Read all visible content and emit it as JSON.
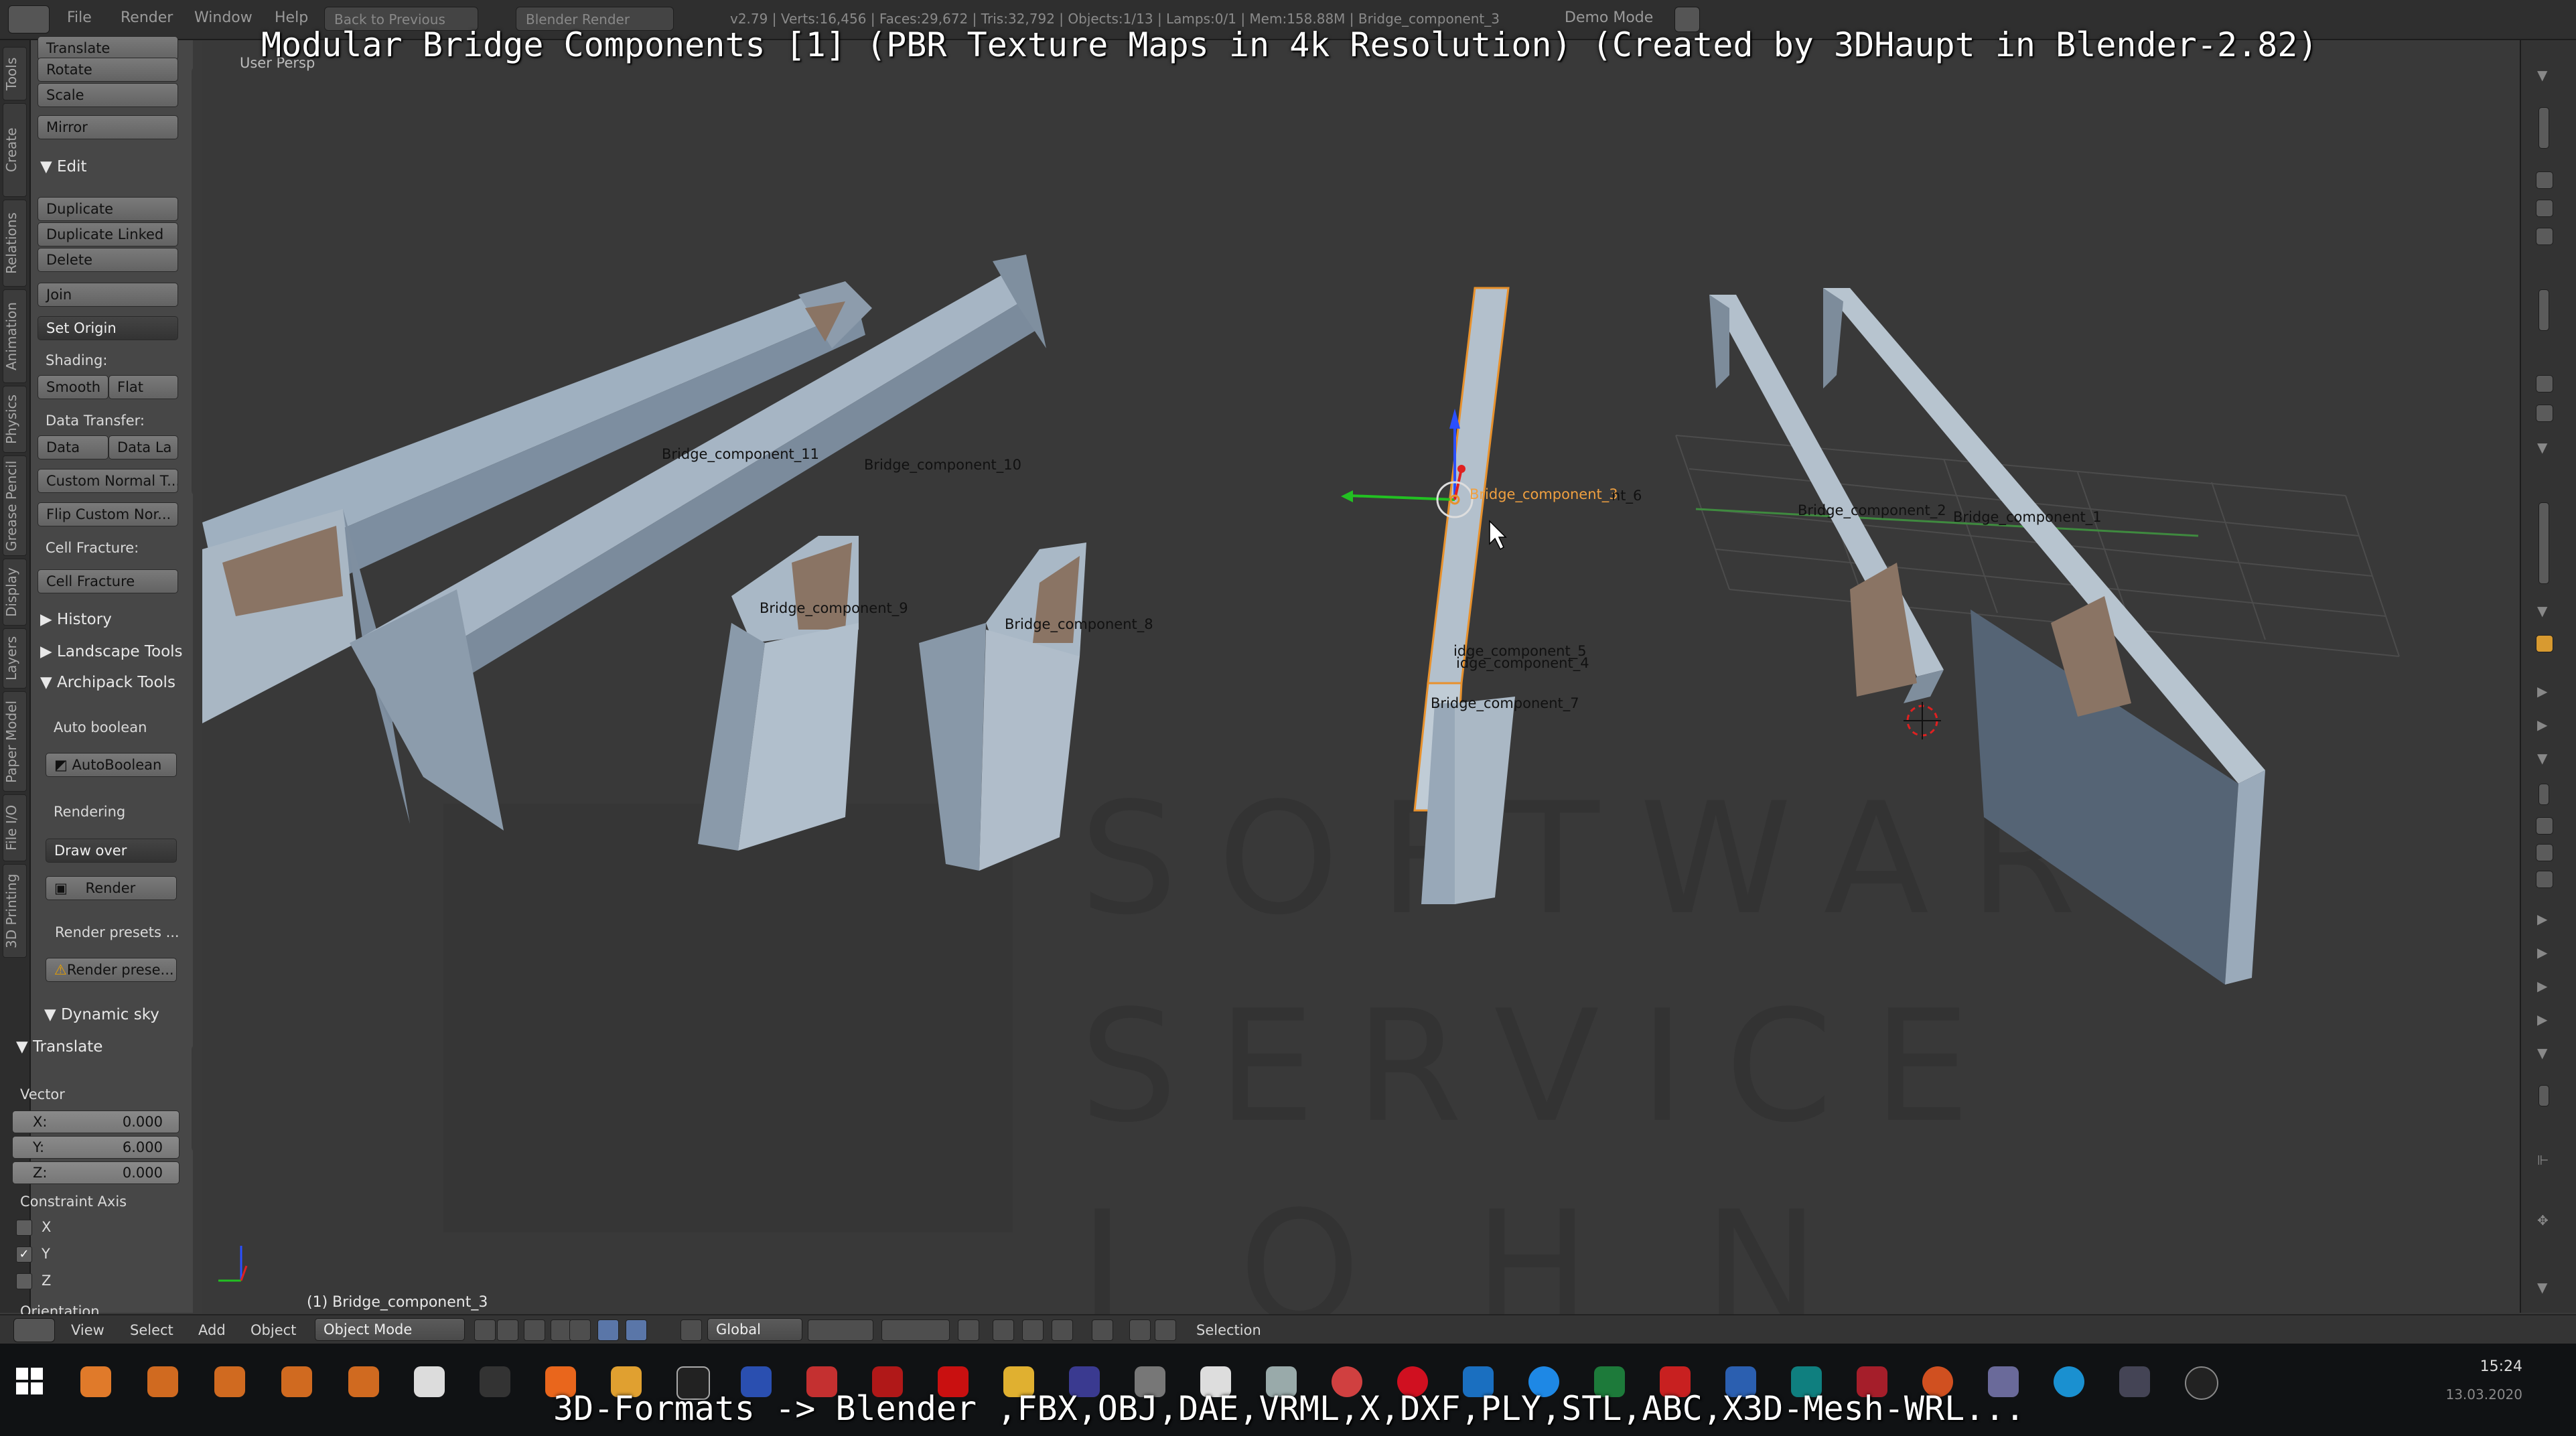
{
  "overlay": {
    "title": "Modular Bridge Components [1] (PBR Texture Maps in 4k Resolution) (Created by 3DHaupt in Blender-2.82)",
    "bottom": "3D-Formats -> Blender ,FBX,OBJ,DAE,VRML,X,DXF,PLY,STL,ABC,X3D-Mesh-WRL..."
  },
  "topbar": {
    "menus": [
      "File",
      "Render",
      "Window",
      "Help"
    ],
    "back_label": "Back to Previous",
    "engine": "Blender Render",
    "stats": "v2.79 | Verts:16,456 | Faces:29,672 | Tris:32,792 | Objects:1/13 | Lamps:0/1 | Mem:158.88M | Bridge_component_3",
    "mode_label": "Demo Mode"
  },
  "vtabs": [
    "Tools",
    "Create",
    "Relations",
    "Animation",
    "Physics",
    "Grease Pencil",
    "Display",
    "Layers",
    "Paper Model",
    "File I/O",
    "3D Printing"
  ],
  "shelf": {
    "transform_buttons": [
      "Translate",
      "Rotate",
      "Scale",
      "Mirror"
    ],
    "edit_header": "Edit",
    "edit_buttons": [
      "Duplicate",
      "Duplicate Linked",
      "Delete"
    ],
    "join": "Join",
    "set_origin": "Set Origin",
    "shading_label": "Shading:",
    "smooth": "Smooth",
    "flat": "Flat",
    "data_transfer_label": "Data Transfer:",
    "data": "Data",
    "data_la": "Data La",
    "custom_normal": "Custom Normal T...",
    "flip_custom": "Flip Custom Nor...",
    "cell_fracture_label": "Cell Fracture:",
    "cell_fracture": "Cell Fracture",
    "history": "History",
    "landscape": "Landscape Tools",
    "archipack": "Archipack Tools",
    "auto_boolean_label": "Auto boolean",
    "auto_boolean": "AutoBoolean",
    "rendering_label": "Rendering",
    "draw_over": "Draw over",
    "render": "Render",
    "render_presets_label": "Render presets ...",
    "render_prese": "Render prese...",
    "dynamic_sky": "Dynamic sky",
    "translate_header": "Translate",
    "vector_label": "Vector",
    "vector": [
      {
        "k": "X:",
        "v": "0.000"
      },
      {
        "k": "Y:",
        "v": "6.000"
      },
      {
        "k": "Z:",
        "v": "0.000"
      }
    ],
    "constraint_label": "Constraint Axis",
    "constraint": [
      {
        "axis": "X",
        "checked": false
      },
      {
        "axis": "Y",
        "checked": true
      },
      {
        "axis": "Z",
        "checked": false
      }
    ],
    "orientation_label": "Orientation"
  },
  "viewport": {
    "view_label": "User Persp",
    "status": "(1) Bridge_component_3",
    "watermark": [
      "SOFTWARE",
      "SERVICE",
      "JOHN"
    ],
    "labels": {
      "c11": "Bridge_component_11",
      "c10": "Bridge_component_10",
      "c9": "Bridge_component_9",
      "c8": "Bridge_component_8",
      "c3": "Bridge_component_3",
      "c6": "nt_6",
      "c5": "idge_component_5",
      "c4": "idge_component_4",
      "c7": "Bridge_component_7",
      "c2": "Bridge_component_2",
      "c1": "Bridge_component_1"
    }
  },
  "viewhdr": {
    "view": "View",
    "select": "Select",
    "add": "Add",
    "object": "Object",
    "mode": "Object Mode",
    "orientation": "Global",
    "selection": "Selection"
  },
  "taskbar": {
    "time": "15:24",
    "date": "13.03.2020"
  },
  "colors": {
    "accent_active": "#f0a040",
    "panel": "#474747",
    "viewport": "#393939"
  }
}
